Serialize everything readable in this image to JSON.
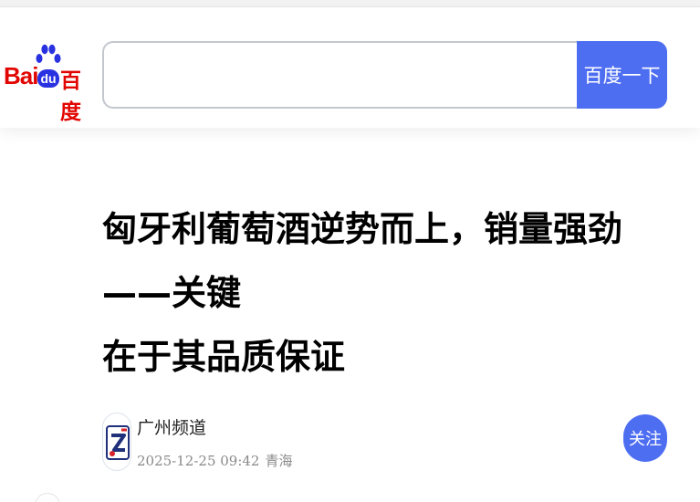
{
  "header": {
    "logo": {
      "text_latin": "Bai",
      "text_du": "du",
      "text_cn": "百度",
      "brand_red": "#e10601",
      "brand_blue": "#2932e1"
    },
    "search": {
      "value": "",
      "placeholder": "",
      "button_label": "百度一下",
      "button_color": "#4e6ef2"
    }
  },
  "article": {
    "title_line1": "匈牙利葡萄酒逆势而上，销量强劲——关键",
    "title_line2": "在于其品质保证",
    "author": {
      "name": "广州频道",
      "date": "2025-12-25 09:42",
      "location": "青海",
      "avatar_icon": "gz-channel-logo-icon",
      "follow_label": "关注"
    }
  }
}
